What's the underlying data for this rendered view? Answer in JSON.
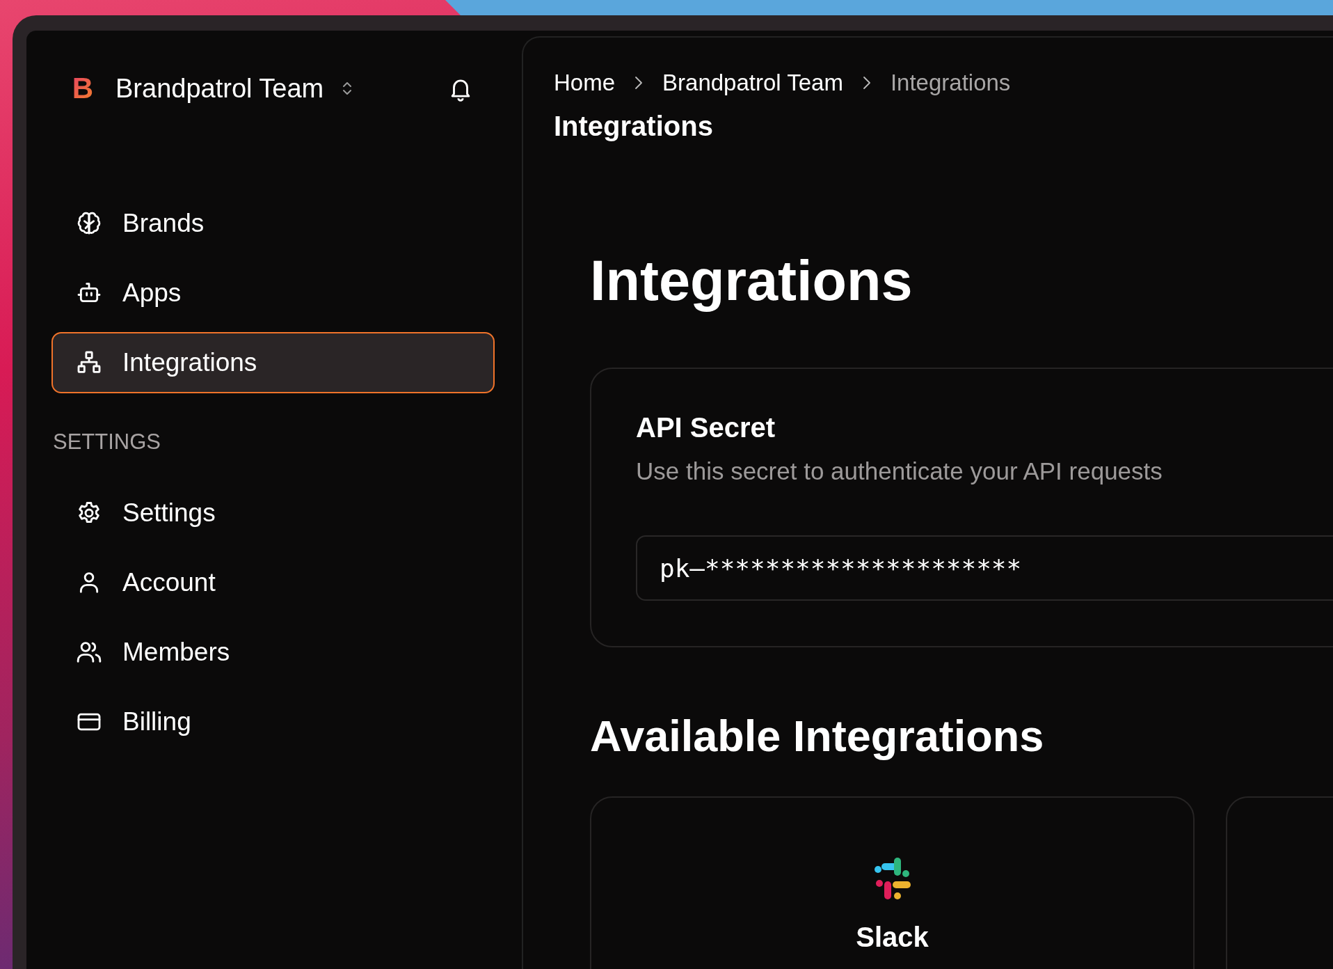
{
  "team": {
    "logo": "B",
    "name": "Brandpatrol Team"
  },
  "nav": [
    {
      "label": "Brands",
      "kind": "brain",
      "selected": false
    },
    {
      "label": "Apps",
      "kind": "robot",
      "selected": false
    },
    {
      "label": "Integrations",
      "kind": "sitemap",
      "selected": true
    }
  ],
  "settings_section": {
    "title": "SETTINGS",
    "items": [
      {
        "label": "Settings",
        "kind": "gear",
        "selected": false
      },
      {
        "label": "Account",
        "kind": "user",
        "selected": false
      },
      {
        "label": "Members",
        "kind": "users",
        "selected": false
      },
      {
        "label": "Billing",
        "kind": "card",
        "selected": false
      }
    ]
  },
  "breadcrumb": [
    {
      "label": "Home",
      "current": false
    },
    {
      "label": "Brandpatrol Team",
      "current": false
    },
    {
      "label": "Integrations",
      "current": true
    }
  ],
  "page_title": "Integrations",
  "heading": "Integrations",
  "api_card": {
    "title": "API Secret",
    "description": "Use this secret to authenticate your API requests",
    "value": "pk–*********************"
  },
  "available": {
    "title": "Available Integrations",
    "cards": [
      {
        "kind": "slack",
        "name": "Slack"
      },
      {
        "kind": "empty"
      }
    ]
  }
}
